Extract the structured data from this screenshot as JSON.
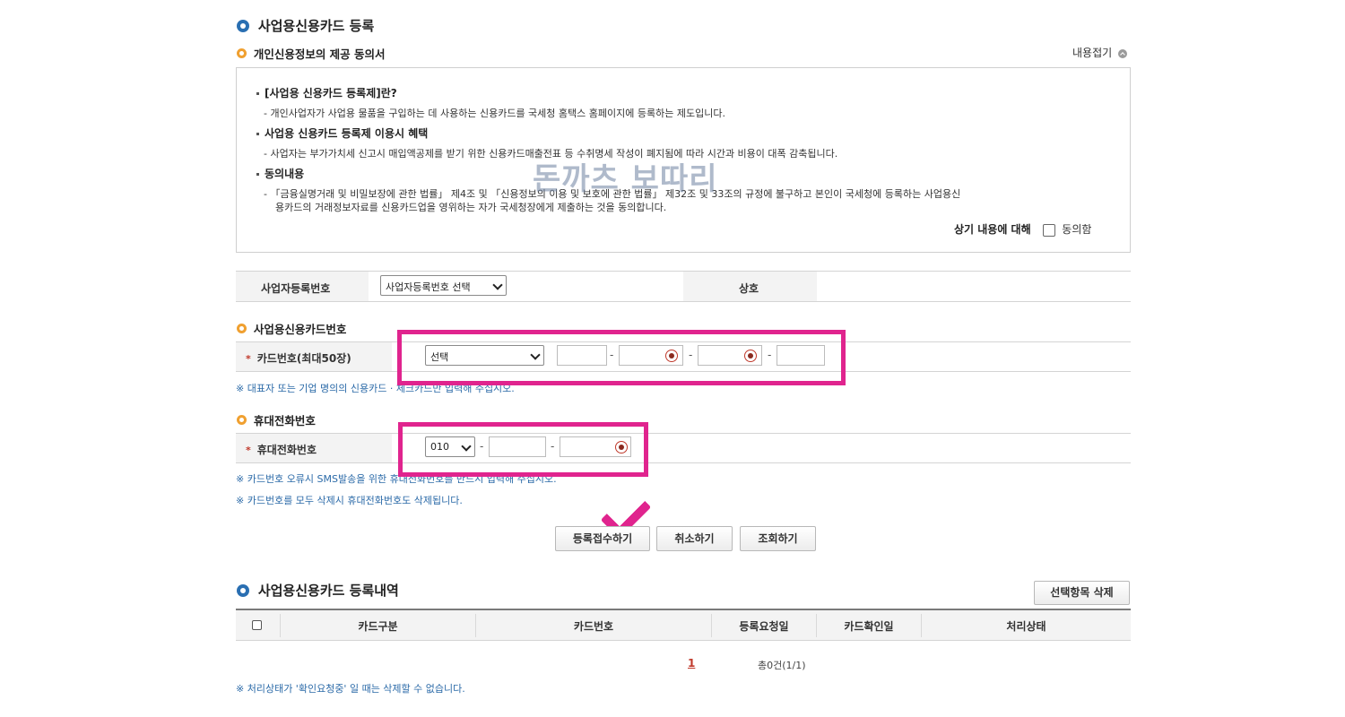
{
  "page_title": "사업용신용카드 등록",
  "consent": {
    "title": "개인신용정보의 제공 동의서",
    "collapse_label": "내용접기",
    "s1_title": "[사업용 신용카드 등록제]란?",
    "s1_text": "- 개인사업자가 사업용 물품을 구입하는 데 사용하는 신용카드를 국세청 홈택스 홈페이지에 등록하는 제도입니다.",
    "s2_title": "사업용 신용카드 등록제 이용시 혜택",
    "s2_text": "- 사업자는 부가가치세 신고시 매입액공제를 받기 위한 신용카드매출전표 등 수취명세 작성이 폐지됨에 따라 시간과 비용이 대폭 감축됩니다.",
    "s3_title": "동의내용",
    "s3_text_1": "- 「금융실명거래 및 비밀보장에 관한 법률」 제4조 및 「신용정보의 이용 및 보호에 관한 법률」 제32조 및 33조의 규정에 불구하고 본인이 국세청에 등록하는 사업용신",
    "s3_text_2": "용카드의   거래정보자료를 신용카드업을 영위하는 자가 국세청장에게 제출하는 것을 동의합니다.",
    "agree_prefix": "상기 내용에 대해",
    "agree_label": "동의함",
    "watermark": "돈까츠 보따리"
  },
  "biz": {
    "label": "사업자등록번호",
    "select_value": "사업자등록번호 선택",
    "name_label": "상호"
  },
  "card": {
    "section_title": "사업용신용카드번호",
    "label": "카드번호(최대50장)",
    "required_mark": "*",
    "select_value": "선택",
    "dash": "-",
    "note": "※ 대표자 또는 기업 명의의 신용카드 · 체크카드만 입력해 주십시오."
  },
  "phone": {
    "section_title": "휴대전화번호",
    "label": "휴대전화번호",
    "required_mark": "*",
    "prefix_value": "010",
    "dash": "-",
    "note1": "※ 카드번호 오류시 SMS발송을 위한 휴대전화번호를 반드시 입력해 주십시오.",
    "note2": "※ 카드번호를 모두 삭제시 휴대전화번호도 삭제됩니다."
  },
  "buttons": {
    "submit": "등록접수하기",
    "cancel": "취소하기",
    "inquiry": "조회하기"
  },
  "history": {
    "title": "사업용신용카드 등록내역",
    "delete_button": "선택항목 삭제",
    "columns": [
      "카드구분",
      "카드번호",
      "등록요청일",
      "카드확인일",
      "처리상태"
    ],
    "page_number": "1",
    "total": "총0건(1/1)",
    "note": "※ 처리상태가 '확인요청중' 일 때는 삭제할 수 없습니다."
  },
  "colors": {
    "highlight": "#e0248e",
    "note_blue": "#2b6aa8",
    "bullet_blue": "#2a6fb2",
    "bullet_orange": "#f0a030"
  }
}
